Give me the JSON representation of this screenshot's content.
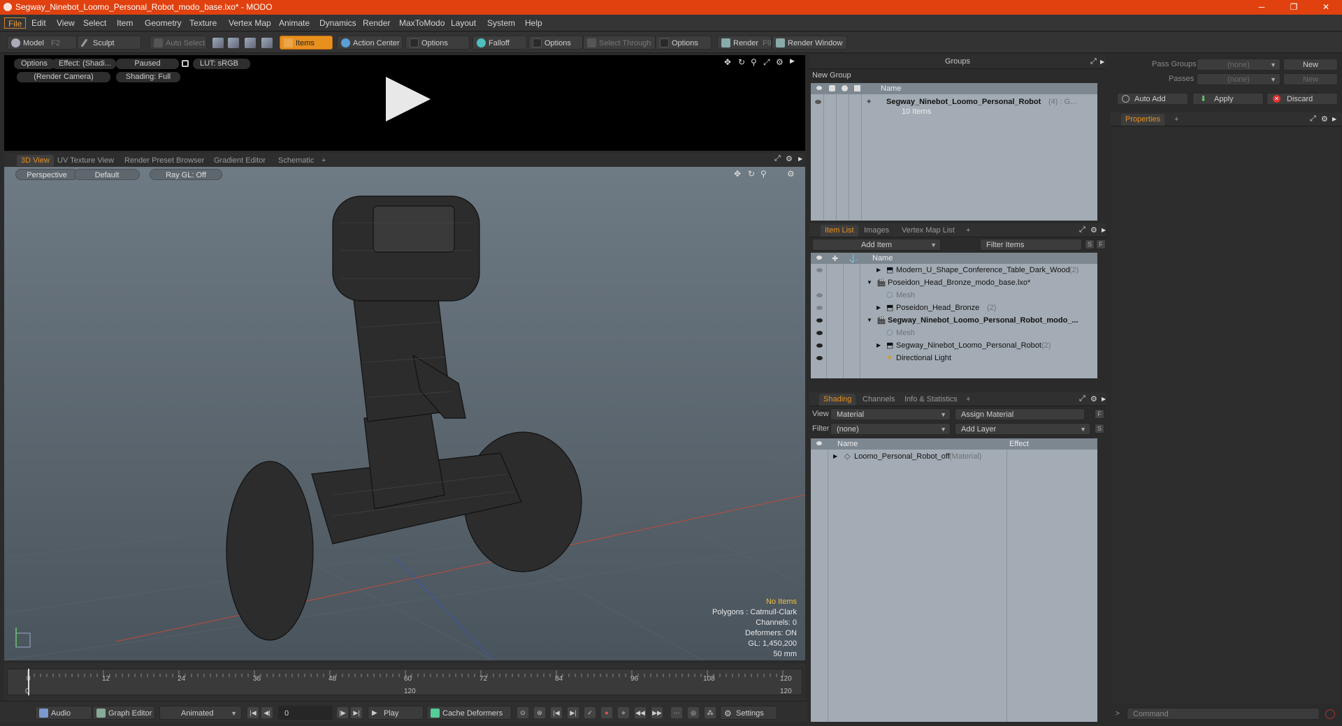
{
  "window": {
    "title": "Segway_Ninebot_Loomo_Personal_Robot_modo_base.lxo* - MODO",
    "minimize": "─",
    "restore": "❐",
    "close": "✕"
  },
  "menu": [
    "File",
    "Edit",
    "View",
    "Select",
    "Item",
    "Geometry",
    "Texture",
    "Vertex Map",
    "Animate",
    "Dynamics",
    "Render",
    "MaxToModo",
    "Layout",
    "System",
    "Help"
  ],
  "toolbar": {
    "model": "Model",
    "model_key": "F2",
    "sculpt": "Sculpt",
    "auto_select": "Auto Select",
    "items": "Items",
    "action_center": "Action Center",
    "options1": "Options",
    "falloff": "Falloff",
    "options2": "Options",
    "select_through": "Select Through",
    "options3": "Options",
    "render": "Render",
    "render_key": "F9",
    "render_window": "Render Window"
  },
  "preview": {
    "options": "Options",
    "effect": "Effect: (Shadi...",
    "paused": "Paused",
    "lut": "LUT: sRGB",
    "camera": "(Render Camera)",
    "shading": "Shading: Full"
  },
  "viewport_tabs": [
    "3D View",
    "UV Texture View",
    "Render Preset Browser",
    "Gradient Editor",
    "Schematic",
    "+"
  ],
  "viewport": {
    "perspective": "Perspective",
    "default": "Default",
    "raygl": "Ray GL: Off",
    "no_items": "No Items",
    "polygons": "Polygons : Catmull-Clark",
    "channels": "Channels: 0",
    "deformers": "Deformers: ON",
    "gl": "GL: 1,450,200",
    "lens": "50 mm"
  },
  "timeline": {
    "ticks": [
      "0",
      "12",
      "24",
      "36",
      "48",
      "60",
      "72",
      "84",
      "96",
      "108",
      "120"
    ],
    "start": "0",
    "mid": "120",
    "end": "120"
  },
  "bottombar": {
    "audio": "Audio",
    "graph_editor": "Graph Editor",
    "animated": "Animated",
    "frame": "0",
    "play": "Play",
    "cache": "Cache Deformers",
    "settings": "Settings"
  },
  "groups": {
    "title": "Groups",
    "new_group": "New Group",
    "col_name": "Name",
    "item_name": "Segway_Ninebot_Loomo_Personal_Robot",
    "item_suffix": "(4) : G...",
    "item_count": "10 Items"
  },
  "item_list": {
    "tabs": [
      "Item List",
      "Images",
      "Vertex Map List",
      "+"
    ],
    "add_item": "Add Item",
    "filter": "Filter Items",
    "s": "S",
    "f": "F",
    "col_name": "Name",
    "rows": [
      {
        "name": "Modern_U_Shape_Conference_Table_Dark_Wood",
        "count": "(2)"
      },
      {
        "name": "Poseidon_Head_Bronze_modo_base.lxo*",
        "count": ""
      },
      {
        "name": "Mesh",
        "count": ""
      },
      {
        "name": "Poseidon_Head_Bronze",
        "count": "(2)"
      },
      {
        "name": "Segway_Ninebot_Loomo_Personal_Robot_modo_...",
        "count": ""
      },
      {
        "name": "Mesh",
        "count": ""
      },
      {
        "name": "Segway_Ninebot_Loomo_Personal_Robot",
        "count": "(2)"
      },
      {
        "name": "Directional Light",
        "count": ""
      }
    ]
  },
  "shading": {
    "tabs": [
      "Shading",
      "Channels",
      "Info & Statistics",
      "+"
    ],
    "view_label": "View",
    "view_value": "Material",
    "assign": "Assign Material",
    "f": "F",
    "filter_label": "Filter",
    "filter_value": "(none)",
    "add_layer": "Add Layer",
    "s": "S",
    "col_name": "Name",
    "col_effect": "Effect",
    "material": "Loomo_Personal_Robot_off",
    "material_type": "(Material)"
  },
  "properties": {
    "pass_groups": "Pass Groups",
    "pass_groups_value": "(none)",
    "new1": "New",
    "passes": "Passes",
    "passes_value": "(none)",
    "new2": "New",
    "auto_add": "Auto Add",
    "apply": "Apply",
    "discard": "Discard",
    "tab": "Properties",
    "plus": "+",
    "command": "Command"
  }
}
